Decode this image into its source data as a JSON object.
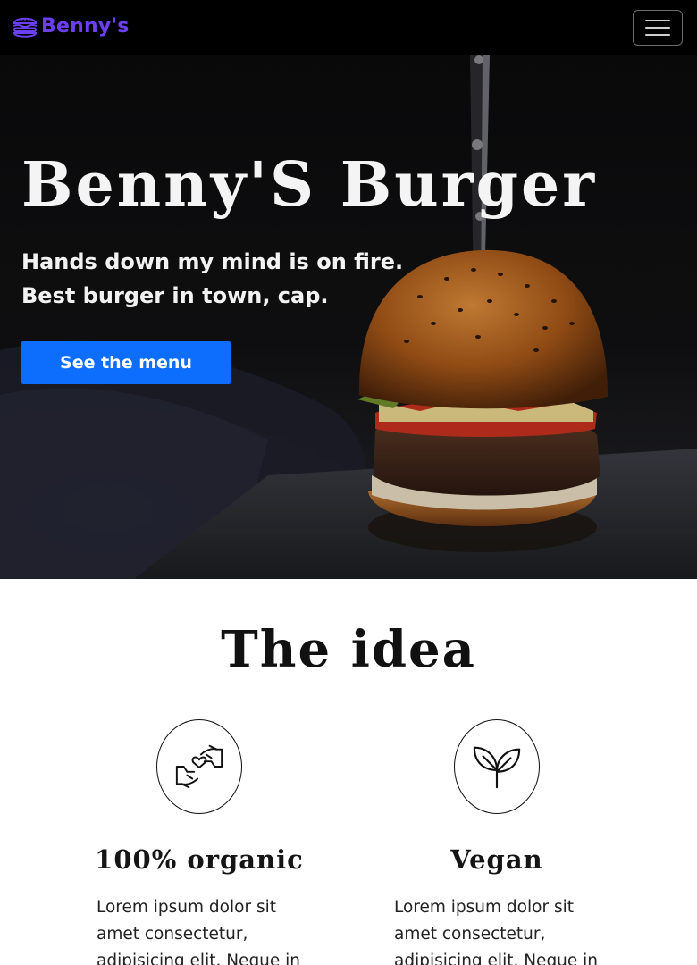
{
  "navbar": {
    "brand": "Benny's",
    "logo_icon": "burger-icon",
    "brand_color": "#6c3ff0",
    "toggler_icon": "hamburger-menu-icon"
  },
  "hero": {
    "title": "Benny'S Burger",
    "subtitle": "Hands down my mind is on fire. Best burger in town, cap.",
    "cta_label": "See the menu",
    "cta_color": "#0d6efd"
  },
  "idea": {
    "title": "The idea",
    "features": [
      {
        "icon": "hands-heart-icon",
        "title": "100% organic",
        "text": "Lorem ipsum dolor sit amet consectetur, adipisicing elit. Neque in"
      },
      {
        "icon": "sprout-leaf-icon",
        "title": "Vegan",
        "text": "Lorem ipsum dolor sit amet consectetur, adipisicing elit. Neque in"
      }
    ]
  }
}
